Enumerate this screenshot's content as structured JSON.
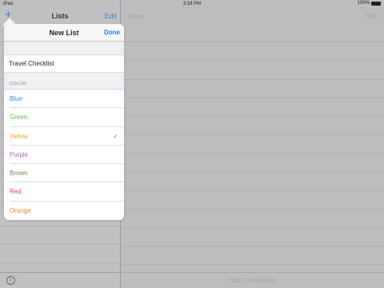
{
  "statusbar": {
    "left": "iPad",
    "time": "3:18 PM",
    "battery": "100%"
  },
  "sidebar": {
    "title": "Lists",
    "add_icon": "+",
    "edit": "Edit",
    "info_icon": "i"
  },
  "main": {
    "reset": "Reset",
    "edit": "Edit",
    "footer": "Hide Completed"
  },
  "popover": {
    "title": "New List",
    "done": "Done",
    "list_name": "Travel Checklist",
    "section_label": "COLOR",
    "selected_color": "Yellow",
    "colors": [
      {
        "label": "Blue",
        "hex": "#2a8bd8"
      },
      {
        "label": "Green",
        "hex": "#58b83a"
      },
      {
        "label": "Yellow",
        "hex": "#e0a50e"
      },
      {
        "label": "Purple",
        "hex": "#b85ad0"
      },
      {
        "label": "Brown",
        "hex": "#8f7650"
      },
      {
        "label": "Red",
        "hex": "#ea3e5c"
      },
      {
        "label": "Orange",
        "hex": "#f1891c"
      }
    ],
    "check_icon": "✓"
  }
}
